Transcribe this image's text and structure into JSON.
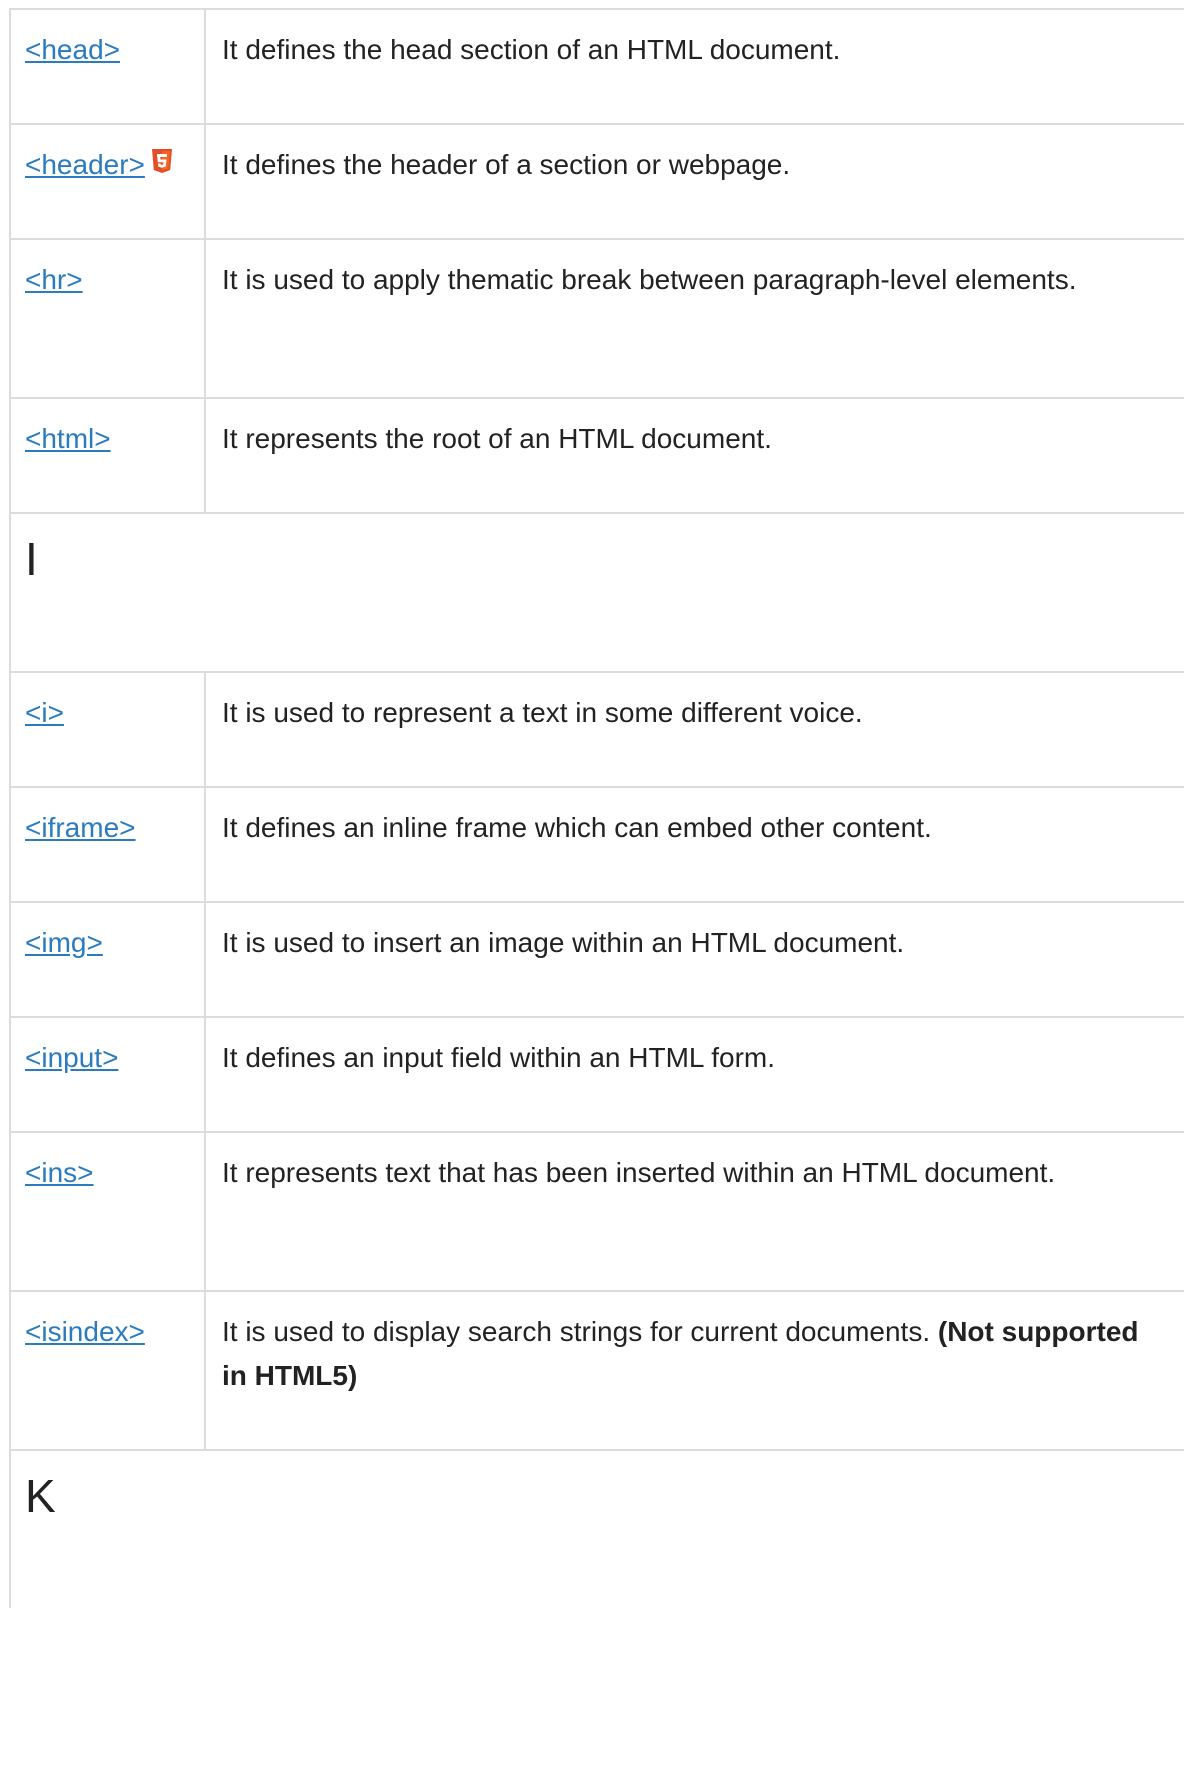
{
  "rows": [
    {
      "type": "tag",
      "tag": "<head>",
      "desc": "It defines the head section of an HTML document.",
      "html5": false
    },
    {
      "type": "tag",
      "tag": "<header>",
      "desc": "It defines the header of a section or webpage.",
      "html5": true
    },
    {
      "type": "tag",
      "tag": "<hr>",
      "desc": "It is used to apply thematic break between paragraph-level elements.",
      "html5": false
    },
    {
      "type": "tag",
      "tag": "<html>",
      "desc": "It represents the root of an HTML document.",
      "html5": false
    },
    {
      "type": "letter",
      "letter": "I"
    },
    {
      "type": "tag",
      "tag": "<i>",
      "desc": "It is used to represent a text in some different voice.",
      "html5": false
    },
    {
      "type": "tag",
      "tag": "<iframe>",
      "desc": "It defines an inline frame which can embed other content.",
      "html5": false
    },
    {
      "type": "tag",
      "tag": "<img>",
      "desc": "It is used to insert an image within an HTML document.",
      "html5": false
    },
    {
      "type": "tag",
      "tag": "<input>",
      "desc": "It defines an input field within an HTML form.",
      "html5": false
    },
    {
      "type": "tag",
      "tag": "<ins>",
      "desc": "It represents text that has been inserted within an HTML document.",
      "html5": false
    },
    {
      "type": "tag",
      "tag": "<isindex>",
      "desc": "It is used to display search strings for current documents.",
      "note": "(Not supported in HTML5)",
      "html5": false
    },
    {
      "type": "letter",
      "letter": "K"
    }
  ],
  "colors": {
    "link": "#2a7bbf",
    "border": "#dcdcdc",
    "text": "#222222",
    "html5_badge": "#e44d26"
  },
  "icons": {
    "html5": "html5-icon"
  }
}
